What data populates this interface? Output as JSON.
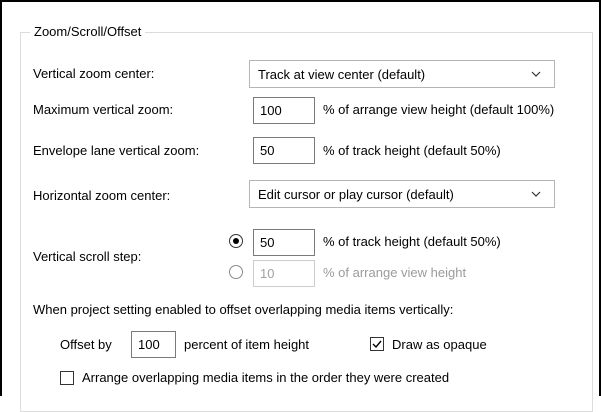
{
  "group": {
    "title": "Zoom/Scroll/Offset"
  },
  "vertical_zoom_center": {
    "label": "Vertical zoom center:",
    "value": "Track at view center (default)"
  },
  "max_vertical_zoom": {
    "label": "Maximum vertical zoom:",
    "value": "100",
    "suffix": "% of arrange view height (default 100%)"
  },
  "envelope_lane_zoom": {
    "label": "Envelope lane vertical zoom:",
    "value": "50",
    "suffix": "% of track height (default 50%)"
  },
  "horizontal_zoom_center": {
    "label": "Horizontal zoom center:",
    "value": "Edit cursor or play cursor (default)"
  },
  "vertical_scroll_step": {
    "label": "Vertical scroll step:",
    "option1_value": "50",
    "option1_suffix": "% of track height (default 50%)",
    "option1_selected": true,
    "option2_value": "10",
    "option2_suffix": "% of arrange view height",
    "option2_selected": false
  },
  "offset_section": {
    "description": "When project setting enabled to offset overlapping media items vertically:",
    "offset_by_label": "Offset by",
    "offset_value": "100",
    "offset_suffix": "percent of item height",
    "draw_opaque_label": "Draw as opaque",
    "draw_opaque_checked": true,
    "arrange_order_label": "Arrange overlapping media items in the order they were created",
    "arrange_order_checked": false
  },
  "colors": {
    "disabled_text": "#9b9b9b",
    "border": "#7a7a7a"
  }
}
